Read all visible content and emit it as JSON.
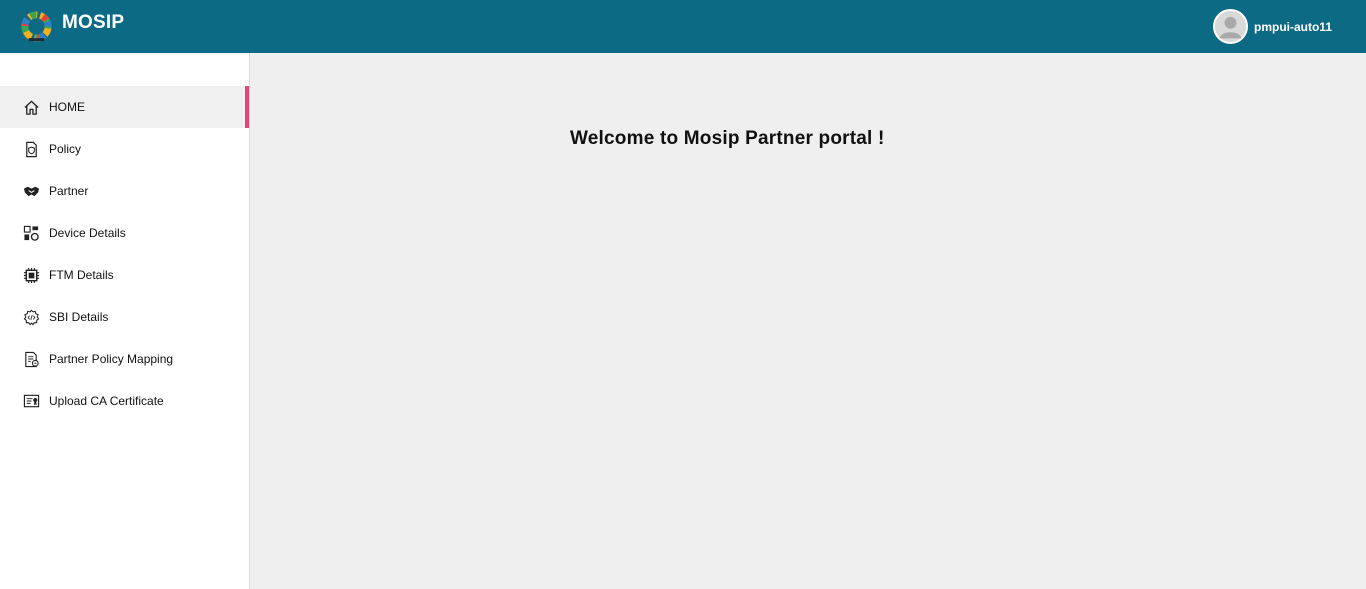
{
  "header": {
    "brand": "MOSIP",
    "logo_icon": "mosip-logo-icon",
    "user": {
      "name": "pmpui-auto11",
      "avatar_icon": "user-avatar-icon"
    },
    "colors": {
      "background": "#0d6a84",
      "text": "#ffffff"
    }
  },
  "sidebar": {
    "active_accent": "#e6437a",
    "items": [
      {
        "label": "HOME",
        "icon": "home-icon",
        "active": true
      },
      {
        "label": "Policy",
        "icon": "policy-icon",
        "active": false
      },
      {
        "label": "Partner",
        "icon": "handshake-icon",
        "active": false
      },
      {
        "label": "Device Details",
        "icon": "device-icon",
        "active": false
      },
      {
        "label": "FTM Details",
        "icon": "chip-icon",
        "active": false
      },
      {
        "label": "SBI Details",
        "icon": "code-gear-icon",
        "active": false
      },
      {
        "label": "Partner Policy Mapping",
        "icon": "document-mapping-icon",
        "active": false
      },
      {
        "label": "Upload CA Certificate",
        "icon": "certificate-icon",
        "active": false
      }
    ]
  },
  "main": {
    "welcome": "Welcome to Mosip Partner portal !"
  }
}
